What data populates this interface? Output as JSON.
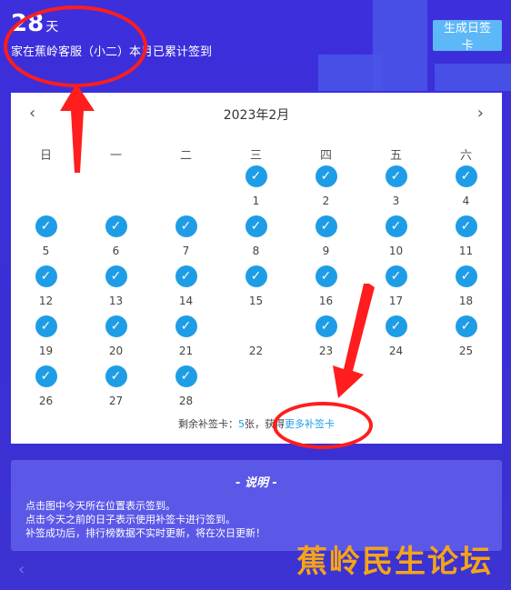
{
  "header": {
    "count": "28",
    "unit": "天",
    "text": "家在蕉岭客服（小二）本月已累计签到",
    "generate_button": "生成日签卡"
  },
  "calendar": {
    "title": "2023年2月",
    "prev": "‹",
    "next": "›",
    "weekdays": [
      "日",
      "一",
      "二",
      "三",
      "四",
      "五",
      "六"
    ],
    "days": [
      {
        "d": "",
        "c": false
      },
      {
        "d": "",
        "c": false
      },
      {
        "d": "",
        "c": false
      },
      {
        "d": "1",
        "c": true
      },
      {
        "d": "2",
        "c": true
      },
      {
        "d": "3",
        "c": true
      },
      {
        "d": "4",
        "c": true
      },
      {
        "d": "5",
        "c": true
      },
      {
        "d": "6",
        "c": true
      },
      {
        "d": "7",
        "c": true
      },
      {
        "d": "8",
        "c": true
      },
      {
        "d": "9",
        "c": true
      },
      {
        "d": "10",
        "c": true
      },
      {
        "d": "11",
        "c": true
      },
      {
        "d": "12",
        "c": true
      },
      {
        "d": "13",
        "c": true
      },
      {
        "d": "14",
        "c": true
      },
      {
        "d": "15",
        "c": true
      },
      {
        "d": "16",
        "c": true
      },
      {
        "d": "17",
        "c": true
      },
      {
        "d": "18",
        "c": true
      },
      {
        "d": "19",
        "c": true
      },
      {
        "d": "20",
        "c": true
      },
      {
        "d": "21",
        "c": true
      },
      {
        "d": "22",
        "c": false
      },
      {
        "d": "23",
        "c": true
      },
      {
        "d": "24",
        "c": true
      },
      {
        "d": "25",
        "c": true
      },
      {
        "d": "26",
        "c": true
      },
      {
        "d": "27",
        "c": true
      },
      {
        "d": "28",
        "c": true
      }
    ],
    "footer_prefix": "剩余补签卡：",
    "footer_count": "5",
    "footer_mid": "张，获得",
    "footer_link": "更多补签卡"
  },
  "description": {
    "title": "- 说明 -",
    "lines": [
      "点击图中今天所在位置表示签到。",
      "点击今天之前的日子表示使用补签卡进行签到。",
      "补签成功后，排行榜数据不实时更新，将在次日更新！"
    ]
  },
  "watermark": "蕉岭民生论坛",
  "back": "‹",
  "colors": {
    "accent": "#1e9de6",
    "annotation": "#ff1d1d",
    "background": "#3b2fd6"
  }
}
